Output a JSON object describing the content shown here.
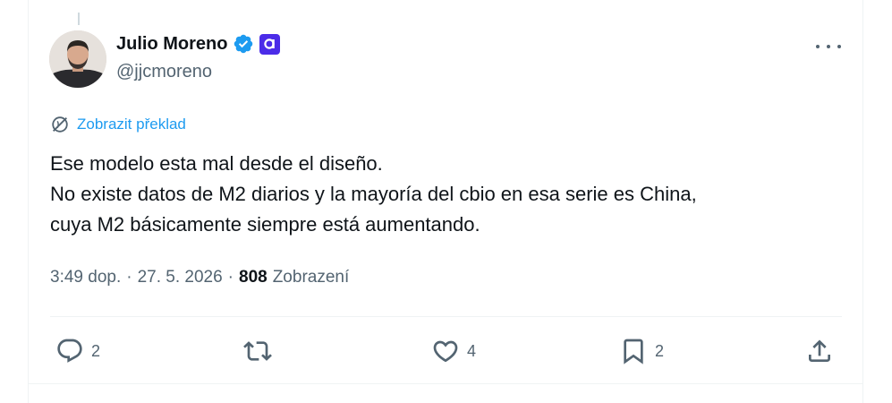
{
  "tweet": {
    "author_name": "Julio Moreno",
    "author_handle": "@jjcmoreno",
    "translate_label": "Zobrazit překlad",
    "text_lines": [
      "Ese modelo esta mal desde el diseño.",
      "No existe datos de M2 diarios y la mayoría del cbio en esa serie es China,",
      "cuya M2 básicamente siempre está aumentando."
    ],
    "time": "3:49 dop.",
    "date": "27. 5. 2026",
    "views_count": "808",
    "views_label": "Zobrazení"
  },
  "actions": {
    "reply_count": "2",
    "like_count": "4",
    "bookmark_count": "2"
  },
  "icons": [
    "verified-badge-icon",
    "affiliate-badge-icon",
    "more-icon",
    "translate-icon",
    "reply-icon",
    "retweet-icon",
    "like-icon",
    "bookmark-icon",
    "share-icon"
  ],
  "colors": {
    "accent": "#1d9bf0",
    "text": "#0f1419",
    "muted": "#536471",
    "affiliate": "#4b2ce8"
  }
}
